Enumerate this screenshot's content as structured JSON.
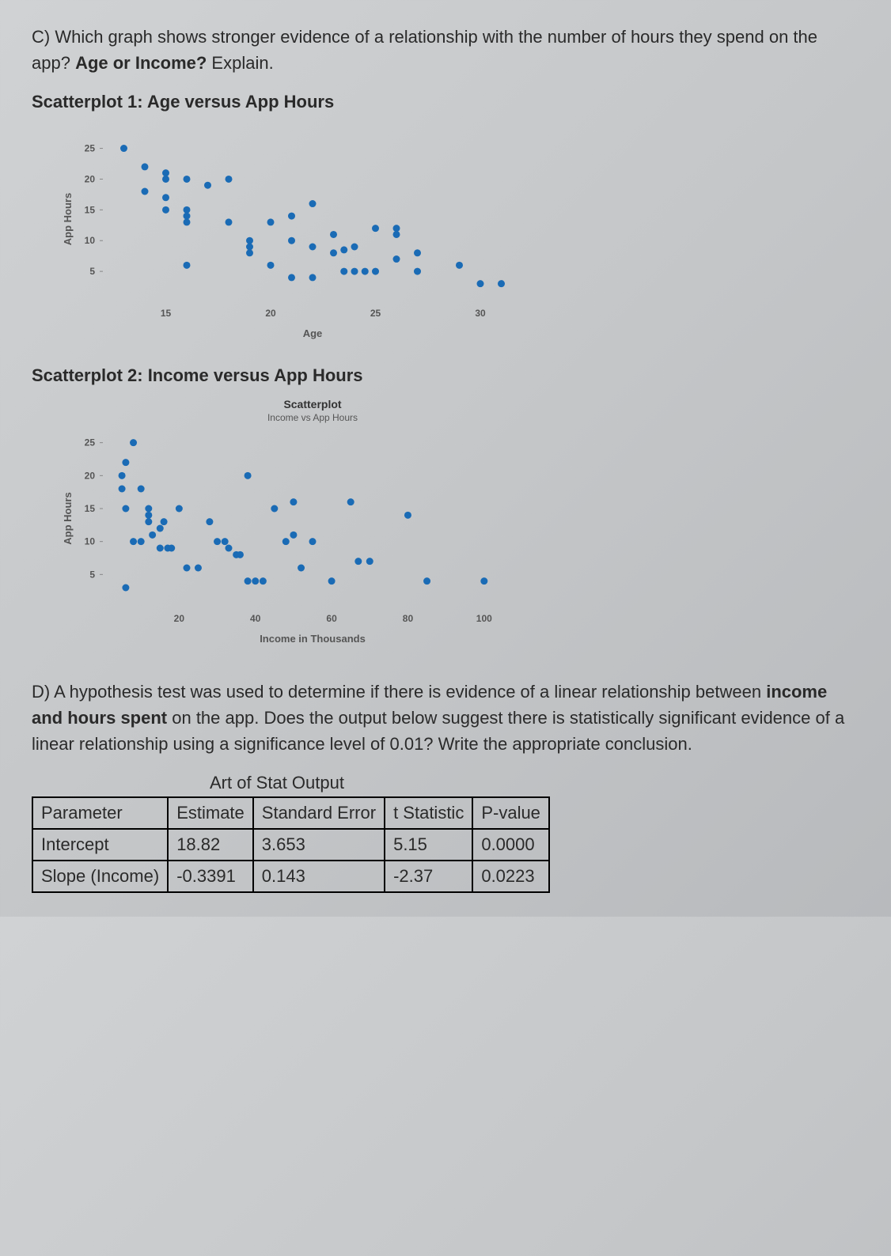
{
  "questionC_part1": "C) Which graph shows stronger evidence of a relationship with the number of hours they spend on the app? ",
  "questionC_bold": "Age or Income?",
  "questionC_part2": " Explain.",
  "scatter1_title": "Scatterplot 1: Age versus App Hours",
  "scatter2_title": "Scatterplot 2: Income versus App Hours",
  "questionD_part1": "D) A hypothesis test was used to determine if there is evidence of a linear relationship between ",
  "questionD_bold": "income and hours spent",
  "questionD_part2": " on the app. Does the output below suggest there is statistically significant evidence of a linear relationship using a significance level of 0.01? Write the appropriate conclusion.",
  "table_title": "Art of Stat Output",
  "table": {
    "headers": [
      "Parameter",
      "Estimate",
      "Standard Error",
      "t Statistic",
      "P-value"
    ],
    "rows": [
      [
        "Intercept",
        "18.82",
        "3.653",
        "5.15",
        "0.0000"
      ],
      [
        "Slope (Income)",
        "-0.3391",
        "0.143",
        "-2.37",
        "0.0223"
      ]
    ]
  },
  "chart_data": [
    {
      "type": "scatter",
      "title": "",
      "xlabel": "Age",
      "ylabel": "App Hours",
      "xlim": [
        12,
        32
      ],
      "ylim": [
        0,
        27
      ],
      "xticks": [
        15,
        20,
        25,
        30
      ],
      "yticks": [
        5,
        10,
        15,
        20,
        25
      ],
      "points": [
        {
          "x": 13,
          "y": 25
        },
        {
          "x": 14,
          "y": 22
        },
        {
          "x": 15,
          "y": 21
        },
        {
          "x": 14,
          "y": 18
        },
        {
          "x": 15,
          "y": 20
        },
        {
          "x": 16,
          "y": 20
        },
        {
          "x": 15,
          "y": 17
        },
        {
          "x": 15,
          "y": 15
        },
        {
          "x": 16,
          "y": 15
        },
        {
          "x": 16,
          "y": 14
        },
        {
          "x": 16,
          "y": 13
        },
        {
          "x": 16,
          "y": 6
        },
        {
          "x": 17,
          "y": 19
        },
        {
          "x": 18,
          "y": 20
        },
        {
          "x": 18,
          "y": 13
        },
        {
          "x": 19,
          "y": 10
        },
        {
          "x": 19,
          "y": 9
        },
        {
          "x": 19,
          "y": 8
        },
        {
          "x": 20,
          "y": 6
        },
        {
          "x": 20,
          "y": 13
        },
        {
          "x": 21,
          "y": 14
        },
        {
          "x": 21,
          "y": 10
        },
        {
          "x": 21,
          "y": 4
        },
        {
          "x": 22,
          "y": 16
        },
        {
          "x": 22,
          "y": 9
        },
        {
          "x": 22,
          "y": 4
        },
        {
          "x": 23,
          "y": 11
        },
        {
          "x": 23,
          "y": 8
        },
        {
          "x": 23.5,
          "y": 8.5
        },
        {
          "x": 23.5,
          "y": 5
        },
        {
          "x": 24,
          "y": 9
        },
        {
          "x": 24,
          "y": 5
        },
        {
          "x": 24.5,
          "y": 5
        },
        {
          "x": 25,
          "y": 12
        },
        {
          "x": 25,
          "y": 5
        },
        {
          "x": 26,
          "y": 11
        },
        {
          "x": 26,
          "y": 12
        },
        {
          "x": 26,
          "y": 7
        },
        {
          "x": 27,
          "y": 8
        },
        {
          "x": 27,
          "y": 5
        },
        {
          "x": 29,
          "y": 6
        },
        {
          "x": 30,
          "y": 3
        },
        {
          "x": 31,
          "y": 3
        }
      ]
    },
    {
      "type": "scatter",
      "title": "Scatterplot",
      "subtitle": "Income vs App Hours",
      "xlabel": "Income in Thousands",
      "ylabel": "App Hours",
      "xlim": [
        0,
        110
      ],
      "ylim": [
        0,
        27
      ],
      "xticks": [
        20,
        40,
        60,
        80,
        100
      ],
      "yticks": [
        5,
        10,
        15,
        20,
        25
      ],
      "points": [
        {
          "x": 8,
          "y": 25
        },
        {
          "x": 6,
          "y": 22
        },
        {
          "x": 5,
          "y": 20
        },
        {
          "x": 5,
          "y": 18
        },
        {
          "x": 6,
          "y": 15
        },
        {
          "x": 10,
          "y": 18
        },
        {
          "x": 12,
          "y": 14
        },
        {
          "x": 12,
          "y": 15
        },
        {
          "x": 12,
          "y": 13
        },
        {
          "x": 13,
          "y": 11
        },
        {
          "x": 15,
          "y": 12
        },
        {
          "x": 15,
          "y": 9
        },
        {
          "x": 16,
          "y": 13
        },
        {
          "x": 17,
          "y": 9
        },
        {
          "x": 18,
          "y": 9
        },
        {
          "x": 20,
          "y": 15
        },
        {
          "x": 8,
          "y": 10
        },
        {
          "x": 10,
          "y": 10
        },
        {
          "x": 22,
          "y": 6
        },
        {
          "x": 25,
          "y": 6
        },
        {
          "x": 28,
          "y": 13
        },
        {
          "x": 30,
          "y": 10
        },
        {
          "x": 32,
          "y": 10
        },
        {
          "x": 33,
          "y": 9
        },
        {
          "x": 35,
          "y": 8
        },
        {
          "x": 36,
          "y": 8
        },
        {
          "x": 38,
          "y": 20
        },
        {
          "x": 38,
          "y": 4
        },
        {
          "x": 40,
          "y": 4
        },
        {
          "x": 42,
          "y": 4
        },
        {
          "x": 45,
          "y": 15
        },
        {
          "x": 48,
          "y": 10
        },
        {
          "x": 50,
          "y": 16
        },
        {
          "x": 50,
          "y": 11
        },
        {
          "x": 52,
          "y": 6
        },
        {
          "x": 55,
          "y": 10
        },
        {
          "x": 60,
          "y": 4
        },
        {
          "x": 65,
          "y": 16
        },
        {
          "x": 67,
          "y": 7
        },
        {
          "x": 70,
          "y": 7
        },
        {
          "x": 80,
          "y": 14
        },
        {
          "x": 85,
          "y": 4
        },
        {
          "x": 100,
          "y": 4
        },
        {
          "x": 6,
          "y": 3
        }
      ]
    }
  ]
}
